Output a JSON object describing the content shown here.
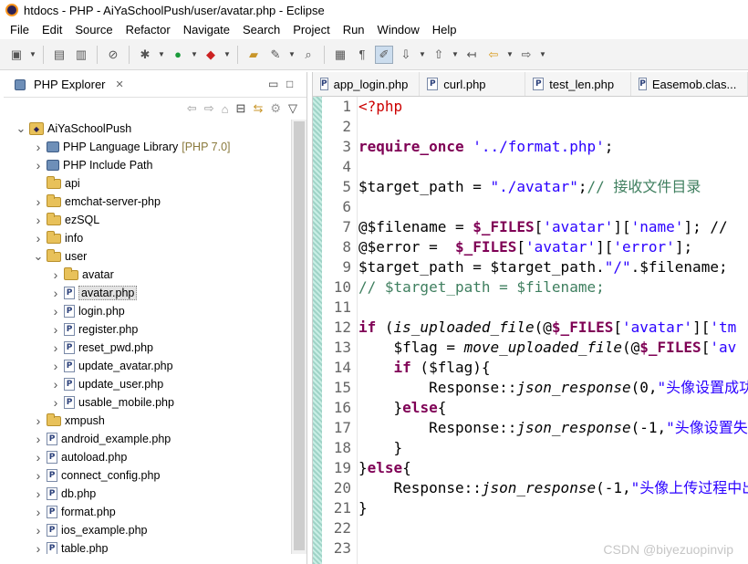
{
  "window": {
    "title": "htdocs - PHP - AiYaSchoolPush/user/avatar.php - Eclipse"
  },
  "menu": [
    {
      "label": "File"
    },
    {
      "label": "Edit"
    },
    {
      "label": "Source"
    },
    {
      "label": "Refactor"
    },
    {
      "label": "Navigate"
    },
    {
      "label": "Search"
    },
    {
      "label": "Project"
    },
    {
      "label": "Run"
    },
    {
      "label": "Window"
    },
    {
      "label": "Help"
    }
  ],
  "explorer": {
    "title": "PHP Explorer",
    "close": "✕",
    "tree": [
      {
        "label": "AiYaSchoolPush",
        "level": 0,
        "icon": "project-icon",
        "expanded": true
      },
      {
        "label": "PHP Language Library",
        "version": "[PHP 7.0]",
        "level": 1,
        "icon": "library-icon",
        "expanded": false
      },
      {
        "label": "PHP Include Path",
        "level": 1,
        "icon": "library-icon",
        "expanded": false
      },
      {
        "label": "api",
        "level": 1,
        "icon": "folder-icon",
        "expanded": null
      },
      {
        "label": "emchat-server-php",
        "level": 1,
        "icon": "folder-icon",
        "expanded": false
      },
      {
        "label": "ezSQL",
        "level": 1,
        "icon": "folder-icon",
        "expanded": false
      },
      {
        "label": "info",
        "level": 1,
        "icon": "folder-icon",
        "expanded": false
      },
      {
        "label": "user",
        "level": 1,
        "icon": "folder-icon",
        "expanded": true
      },
      {
        "label": "avatar",
        "level": 2,
        "icon": "folder-icon",
        "expanded": false
      },
      {
        "label": "avatar.php",
        "level": 2,
        "icon": "php-file-icon",
        "expanded": false,
        "selected": true
      },
      {
        "label": "login.php",
        "level": 2,
        "icon": "php-file-icon",
        "expanded": false
      },
      {
        "label": "register.php",
        "level": 2,
        "icon": "php-file-icon",
        "expanded": false
      },
      {
        "label": "reset_pwd.php",
        "level": 2,
        "icon": "php-file-icon",
        "expanded": false
      },
      {
        "label": "update_avatar.php",
        "level": 2,
        "icon": "php-file-icon",
        "expanded": false
      },
      {
        "label": "update_user.php",
        "level": 2,
        "icon": "php-file-icon",
        "expanded": false
      },
      {
        "label": "usable_mobile.php",
        "level": 2,
        "icon": "php-file-icon",
        "expanded": false
      },
      {
        "label": "xmpush",
        "level": 1,
        "icon": "folder-icon",
        "expanded": false
      },
      {
        "label": "android_example.php",
        "level": 1,
        "icon": "php-file-icon",
        "expanded": false
      },
      {
        "label": "autoload.php",
        "level": 1,
        "icon": "php-file-icon",
        "expanded": false
      },
      {
        "label": "connect_config.php",
        "level": 1,
        "icon": "php-file-icon",
        "expanded": false
      },
      {
        "label": "db.php",
        "level": 1,
        "icon": "php-file-icon",
        "expanded": false
      },
      {
        "label": "format.php",
        "level": 1,
        "icon": "php-file-icon",
        "expanded": false
      },
      {
        "label": "ios_example.php",
        "level": 1,
        "icon": "php-file-icon",
        "expanded": false
      },
      {
        "label": "table.php",
        "level": 1,
        "icon": "php-file-icon",
        "expanded": false
      }
    ]
  },
  "editor": {
    "tabs": [
      {
        "label": "app_login.php"
      },
      {
        "label": "curl.php"
      },
      {
        "label": "test_len.php"
      },
      {
        "label": "Easemob.clas..."
      }
    ],
    "line_numbers": [
      "1",
      "2",
      "3",
      "4",
      "5",
      "6",
      "7",
      "8",
      "9",
      "10",
      "11",
      "12",
      "13",
      "14",
      "15",
      "16",
      "17",
      "18",
      "19",
      "20",
      "21",
      "22",
      "23"
    ],
    "lines": [
      [
        {
          "t": "<?php",
          "c": "tag"
        }
      ],
      [],
      [
        {
          "t": "require_once",
          "c": "kw"
        },
        {
          "t": " "
        },
        {
          "t": "'../format.php'",
          "c": "str"
        },
        {
          "t": ";"
        }
      ],
      [],
      [
        {
          "t": "$target_path = "
        },
        {
          "t": "\"./avatar\"",
          "c": "str"
        },
        {
          "t": ";"
        },
        {
          "t": "// 接收文件目录",
          "c": "cm"
        }
      ],
      [],
      [
        {
          "t": "@$filename = "
        },
        {
          "t": "$_FILES",
          "c": "sup"
        },
        {
          "t": "["
        },
        {
          "t": "'avatar'",
          "c": "str"
        },
        {
          "t": "]["
        },
        {
          "t": "'name'",
          "c": "str"
        },
        {
          "t": "]; //"
        }
      ],
      [
        {
          "t": "@$error =  "
        },
        {
          "t": "$_FILES",
          "c": "sup"
        },
        {
          "t": "["
        },
        {
          "t": "'avatar'",
          "c": "str"
        },
        {
          "t": "]["
        },
        {
          "t": "'error'",
          "c": "str"
        },
        {
          "t": "];"
        }
      ],
      [
        {
          "t": "$target_path = $target_path."
        },
        {
          "t": "\"/\"",
          "c": "str"
        },
        {
          "t": ".$filename;"
        }
      ],
      [
        {
          "t": "// $target_path = $filename;",
          "c": "cm"
        }
      ],
      [],
      [
        {
          "t": "if",
          "c": "kw"
        },
        {
          "t": " ("
        },
        {
          "t": "is_uploaded_file",
          "c": "fn"
        },
        {
          "t": "(@"
        },
        {
          "t": "$_FILES",
          "c": "sup"
        },
        {
          "t": "["
        },
        {
          "t": "'avatar'",
          "c": "str"
        },
        {
          "t": "]["
        },
        {
          "t": "'tm",
          "c": "str"
        }
      ],
      [
        {
          "t": "    $flag = "
        },
        {
          "t": "move_uploaded_file",
          "c": "fn"
        },
        {
          "t": "(@"
        },
        {
          "t": "$_FILES",
          "c": "sup"
        },
        {
          "t": "["
        },
        {
          "t": "'av",
          "c": "str"
        }
      ],
      [
        {
          "t": "    "
        },
        {
          "t": "if",
          "c": "kw"
        },
        {
          "t": " ($flag){"
        }
      ],
      [
        {
          "t": "        Response::"
        },
        {
          "t": "json_response",
          "c": "fn"
        },
        {
          "t": "(0,"
        },
        {
          "t": "\"头像设置成功",
          "c": "str"
        }
      ],
      [
        {
          "t": "    }"
        },
        {
          "t": "else",
          "c": "kw"
        },
        {
          "t": "{"
        }
      ],
      [
        {
          "t": "        Response::"
        },
        {
          "t": "json_response",
          "c": "fn"
        },
        {
          "t": "(-1,"
        },
        {
          "t": "\"头像设置失",
          "c": "str"
        }
      ],
      [
        {
          "t": "    }"
        }
      ],
      [
        {
          "t": "}"
        },
        {
          "t": "else",
          "c": "kw"
        },
        {
          "t": "{"
        }
      ],
      [
        {
          "t": "    Response::"
        },
        {
          "t": "json_response",
          "c": "fn"
        },
        {
          "t": "(-1,"
        },
        {
          "t": "\"头像上传过程中出",
          "c": "str"
        }
      ],
      [
        {
          "t": "}"
        }
      ],
      [],
      []
    ]
  },
  "watermark": "CSDN @biyezuopinvip"
}
